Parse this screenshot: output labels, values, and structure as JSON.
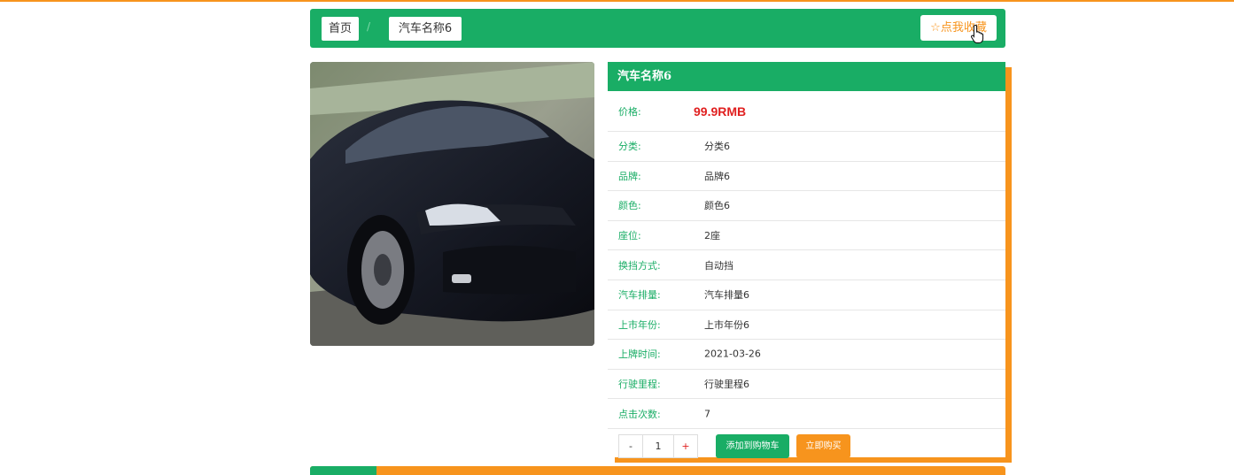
{
  "breadcrumb": {
    "home": "首页",
    "separator": "/",
    "current": "汽车名称6"
  },
  "favorite": {
    "label": "☆点我收藏"
  },
  "product": {
    "title": "汽车名称6",
    "price_label": "价格:",
    "price_value": "99.9RMB",
    "specs": [
      {
        "label": "分类:",
        "value": "分类6"
      },
      {
        "label": "品牌:",
        "value": "品牌6"
      },
      {
        "label": "颜色:",
        "value": "颜色6"
      },
      {
        "label": "座位:",
        "value": "2座"
      },
      {
        "label": "换挡方式:",
        "value": "自动挡"
      },
      {
        "label": "汽车排量:",
        "value": "汽车排量6"
      },
      {
        "label": "上市年份:",
        "value": "上市年份6"
      },
      {
        "label": "上牌时间:",
        "value": "2021-03-26"
      },
      {
        "label": "行驶里程:",
        "value": "行驶里程6"
      },
      {
        "label": "点击次数:",
        "value": "7"
      }
    ]
  },
  "quantity": {
    "minus": "-",
    "value": "1",
    "plus": "+"
  },
  "actions": {
    "add_to_cart": "添加到购物车",
    "buy_now": "立即购买"
  },
  "colors": {
    "brand_green": "#19ad65",
    "accent_orange": "#f7941d",
    "price_red": "#e02020"
  }
}
